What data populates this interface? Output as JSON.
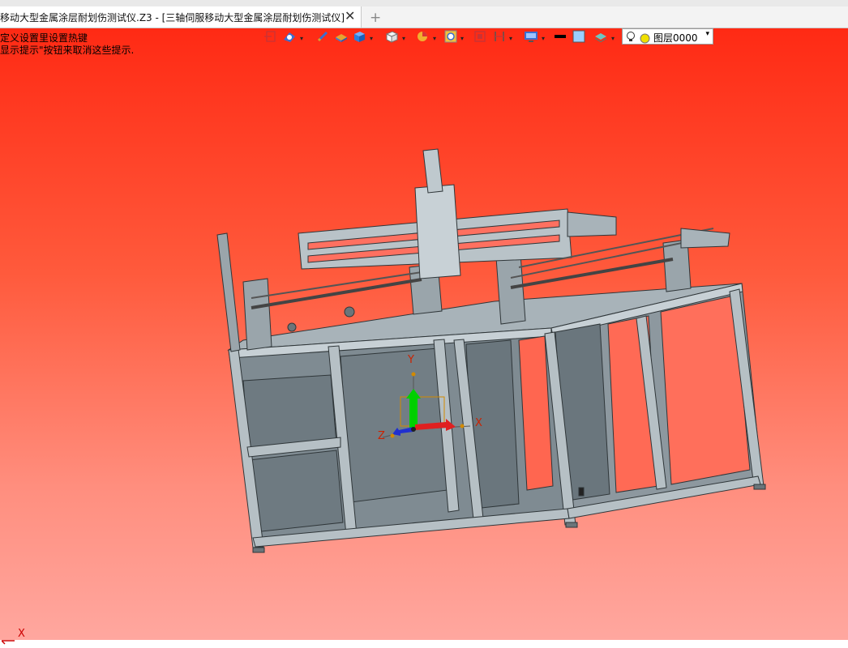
{
  "tab": {
    "title": "移动大型金属涂层耐划伤测试仪.Z3 - [三轴伺服移动大型金属涂层耐划伤测试仪]",
    "close_symbol": "✕",
    "add_symbol": "+"
  },
  "hints": {
    "line1": "定义设置里设置热键",
    "line2": "显示提示\"按钮来取消这些提示."
  },
  "layer": {
    "label": "图层0000",
    "dropdown": "▾"
  },
  "axes": {
    "x": "X",
    "y": "Y",
    "z": "Z"
  },
  "corner_axis": "X",
  "colors": {
    "background_top": "#ff2a14",
    "background_bottom": "#ffa79f",
    "machine": "#8a959c",
    "frame_edge": "#3b4246"
  }
}
